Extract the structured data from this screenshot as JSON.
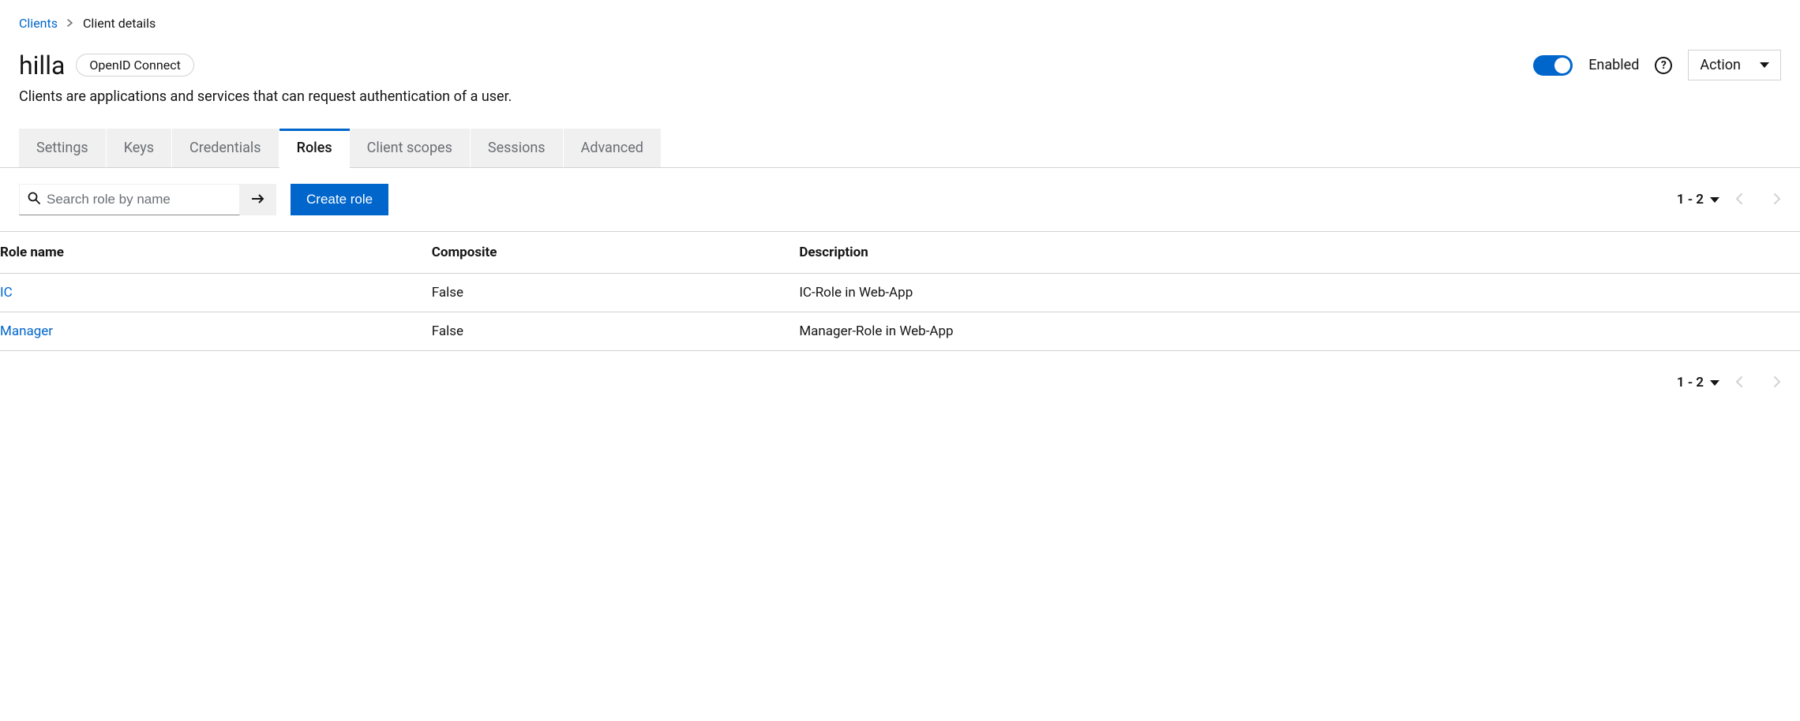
{
  "breadcrumb": {
    "parent": "Clients",
    "current": "Client details"
  },
  "client": {
    "name": "hilla",
    "protocol": "OpenID Connect",
    "description": "Clients are applications and services that can request authentication of a user."
  },
  "header": {
    "enabled_label": "Enabled",
    "action_label": "Action"
  },
  "tabs": [
    {
      "id": "settings",
      "label": "Settings",
      "active": false
    },
    {
      "id": "keys",
      "label": "Keys",
      "active": false
    },
    {
      "id": "credentials",
      "label": "Credentials",
      "active": false
    },
    {
      "id": "roles",
      "label": "Roles",
      "active": true
    },
    {
      "id": "client-scopes",
      "label": "Client scopes",
      "active": false
    },
    {
      "id": "sessions",
      "label": "Sessions",
      "active": false
    },
    {
      "id": "advanced",
      "label": "Advanced",
      "active": false
    }
  ],
  "toolbar": {
    "search_placeholder": "Search role by name",
    "create_label": "Create role"
  },
  "pagination": {
    "range": "1 - 2"
  },
  "table": {
    "columns": {
      "name": "Role name",
      "composite": "Composite",
      "description": "Description"
    },
    "rows": [
      {
        "name": "IC",
        "composite": "False",
        "description": "IC-Role in Web-App"
      },
      {
        "name": "Manager",
        "composite": "False",
        "description": "Manager-Role in Web-App"
      }
    ]
  }
}
